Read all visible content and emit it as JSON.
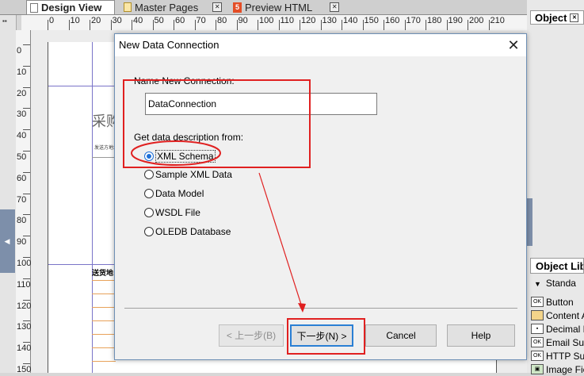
{
  "tabs": {
    "design": "Design View",
    "master": "Master Pages",
    "preview": "Preview HTML"
  },
  "left_strip": {
    "glyph_top": "▪▪",
    "glyph_mid": "◀"
  },
  "ruler": {
    "h": [
      "0",
      "10",
      "20",
      "30",
      "40",
      "50",
      "60",
      "70",
      "80",
      "90",
      "100",
      "110",
      "120",
      "130",
      "140",
      "150",
      "160",
      "170",
      "180",
      "190",
      "200",
      "210"
    ],
    "v": [
      "0",
      "10",
      "20",
      "30",
      "40",
      "50",
      "60",
      "70",
      "80",
      "90",
      "100",
      "110",
      "120",
      "130",
      "140",
      "150"
    ]
  },
  "page_content": {
    "heading": "采购",
    "small_text": "发送方地址",
    "label_text": "送货地:"
  },
  "right_panel": {
    "object_tab": "Object",
    "library_title": "Object Libr",
    "section": "Standa",
    "items": [
      "Button",
      "Content A",
      "Decimal F",
      "Email Sub",
      "HTTP Sub",
      "Image Fie"
    ],
    "icons": [
      "OK",
      "",
      "▪",
      "OK",
      "OK",
      "▣"
    ]
  },
  "dialog": {
    "title": "New Data Connection",
    "close_glyph": "✕",
    "name_label": "Name New Connection:",
    "name_value": "DataConnection",
    "source_label": "Get data description from:",
    "options": [
      "XML Schema",
      "Sample XML Data",
      "Data Model",
      "WSDL File",
      "OLEDB Database"
    ],
    "selected": 0,
    "buttons": {
      "back": "< 上一步(B)",
      "next": "下一步(N) >",
      "cancel": "Cancel",
      "help": "Help"
    }
  },
  "annotation_color": "#e02020"
}
